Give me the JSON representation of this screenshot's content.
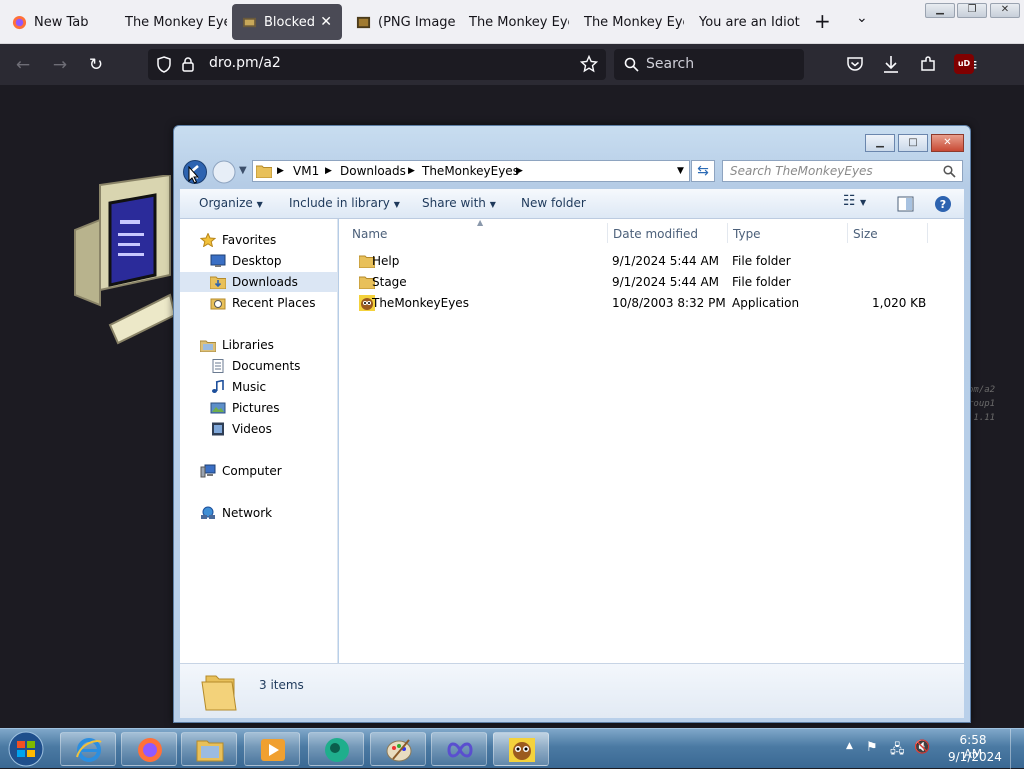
{
  "browser": {
    "tabs": [
      {
        "label": "New Tab"
      },
      {
        "label": "The Monkey Eyes"
      },
      {
        "label": "Blocked"
      },
      {
        "label": "(PNG Image,"
      },
      {
        "label": "The Monkey Eyes"
      },
      {
        "label": "The Monkey Eyes"
      },
      {
        "label": "You are an Idiot!"
      }
    ],
    "url": "dro.pm/a2",
    "search_placeholder": "Search",
    "ublock_badge": "uD"
  },
  "page_sidetext": [
    "om/a2",
    "roup1",
    ".1.11"
  ],
  "explorer": {
    "breadcrumbs": [
      "VM1",
      "Downloads",
      "TheMonkeyEyes"
    ],
    "search_placeholder": "Search TheMonkeyEyes",
    "commands": {
      "organize": "Organize",
      "include": "Include in library",
      "share": "Share with",
      "new_folder": "New folder"
    },
    "nav": {
      "favorites": "Favorites",
      "desktop": "Desktop",
      "downloads": "Downloads",
      "recent": "Recent Places",
      "libraries": "Libraries",
      "documents": "Documents",
      "music": "Music",
      "pictures": "Pictures",
      "videos": "Videos",
      "computer": "Computer",
      "network": "Network"
    },
    "columns": {
      "name": "Name",
      "date": "Date modified",
      "type": "Type",
      "size": "Size"
    },
    "files": [
      {
        "name": "Help",
        "date": "9/1/2024 5:44 AM",
        "type": "File folder",
        "size": ""
      },
      {
        "name": "Stage",
        "date": "9/1/2024 5:44 AM",
        "type": "File folder",
        "size": ""
      },
      {
        "name": "TheMonkeyEyes",
        "date": "10/8/2003 8:32 PM",
        "type": "Application",
        "size": "1,020 KB"
      }
    ],
    "status": "3 items"
  },
  "taskbar": {
    "time": "6:58 AM",
    "date": "9/1/2024"
  }
}
